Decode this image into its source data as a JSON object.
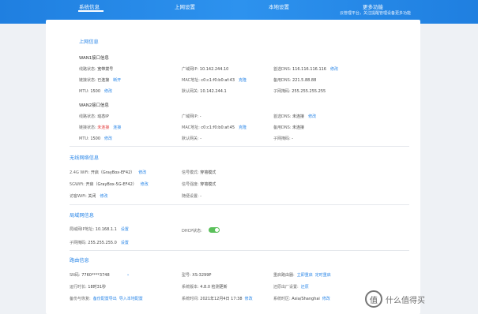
{
  "nav": {
    "tabs": [
      {
        "label": "系统信息"
      },
      {
        "label": "上网设置"
      },
      {
        "label": "本地设置"
      },
      {
        "label": "更多功能"
      }
    ],
    "cloud_note": "云管理平台，关注提醒管理设备更多功能"
  },
  "internet": {
    "title": "上网信息",
    "wan1": {
      "title": "WAN1接口信息",
      "status": {
        "label": "线路状态:",
        "value": "宽带拨号"
      },
      "conn": {
        "label": "链接状态:",
        "value": "已连接",
        "action": "断开"
      },
      "mtu": {
        "label": "MTU:",
        "value": "1500",
        "action": "修改"
      },
      "ip": {
        "label": "广域网IP:",
        "value": "10.142.244.10"
      },
      "mac": {
        "label": "MAC地址:",
        "value": "c0:c1:f0:b0:af:43",
        "action": "克隆"
      },
      "gateway": {
        "label": "默认网关:",
        "value": "10.142.244.1"
      },
      "dns1": {
        "label": "首选DNS:",
        "value": "116.116.116.116",
        "action": "修改"
      },
      "dns2": {
        "label": "备用DNS:",
        "value": "221.5.88.88"
      },
      "mask": {
        "label": "子网掩码:",
        "value": "255.255.255.255"
      }
    },
    "wan2": {
      "title": "WAN2接口信息",
      "status": {
        "label": "线路状态:",
        "value": "动态IP"
      },
      "conn": {
        "label": "链接状态:",
        "value": "未连接",
        "action": "连接"
      },
      "mtu": {
        "label": "MTU:",
        "value": "1500",
        "action": "修改"
      },
      "ip": {
        "label": "广域网IP:",
        "value": "-"
      },
      "mac": {
        "label": "MAC地址:",
        "value": "c0:c1:f0:b0:af:45",
        "action": "克隆"
      },
      "gateway": {
        "label": "默认网关:",
        "value": "-"
      },
      "dns1": {
        "label": "首选DNS:",
        "value": "未连接",
        "action": "修改"
      },
      "dns2": {
        "label": "备用DNS:",
        "value": "未连接"
      },
      "mask": {
        "label": "子网掩码:",
        "value": "-"
      }
    }
  },
  "wireless": {
    "title": "无线网络信息",
    "w24": {
      "label": "2.4G WiFi:",
      "value": "开启（GrayBox-EF42）",
      "action": "修改"
    },
    "w5": {
      "label": "5GWiFi:",
      "value": "开启（GrayBox-5G-EF42）",
      "action": "修改"
    },
    "guest": {
      "label": "访客WiFi:",
      "value": "关闭",
      "action": "修改"
    },
    "mode": {
      "label": "信号模式:",
      "value": "穿墙模式"
    },
    "strength": {
      "label": "信号强度:",
      "value": "穿墙模式"
    },
    "sched": {
      "label": "随便设置:",
      "value": "-"
    }
  },
  "lan": {
    "title": "局域网信息",
    "ip": {
      "label": "局域网IP地址:",
      "value": "10.168.1.1",
      "action": "设置"
    },
    "mask": {
      "label": "子网掩码:",
      "value": "255.255.255.0",
      "action": "设置"
    },
    "dhcp": {
      "label": "DHCP状态:",
      "value": "on"
    }
  },
  "router": {
    "title": "路由信息",
    "sn": {
      "label": "SN码:",
      "value": "7760****3748"
    },
    "uptime": {
      "label": "运行时长:",
      "value": "18时31秒"
    },
    "backup": {
      "label": "备份与恢复:",
      "action1": "备份配置导出",
      "action2": "导入本地配置"
    },
    "model": {
      "label": "型号:",
      "value": "XS-3299P"
    },
    "fw": {
      "label": "系统版本:",
      "value": "4.8.0 检测更新"
    },
    "time": {
      "label": "系统时间:",
      "value": "2021年12月4日 17:38",
      "action": "修改"
    },
    "restart": {
      "label": "重启路由器:",
      "action1": "立即重启",
      "action2": "定时重启"
    },
    "reset": {
      "label": "还原出厂设置:",
      "action": "还原"
    },
    "tz": {
      "label": "系统时区:",
      "value": "Asia/Shanghai",
      "action": "修改"
    }
  },
  "watermark": {
    "text": "什么值得买"
  },
  "colors": {
    "accent": "#2b87e8",
    "topbar": "#2d92ee",
    "warn": "#e23b3b",
    "toggle": "#5ac05a"
  }
}
